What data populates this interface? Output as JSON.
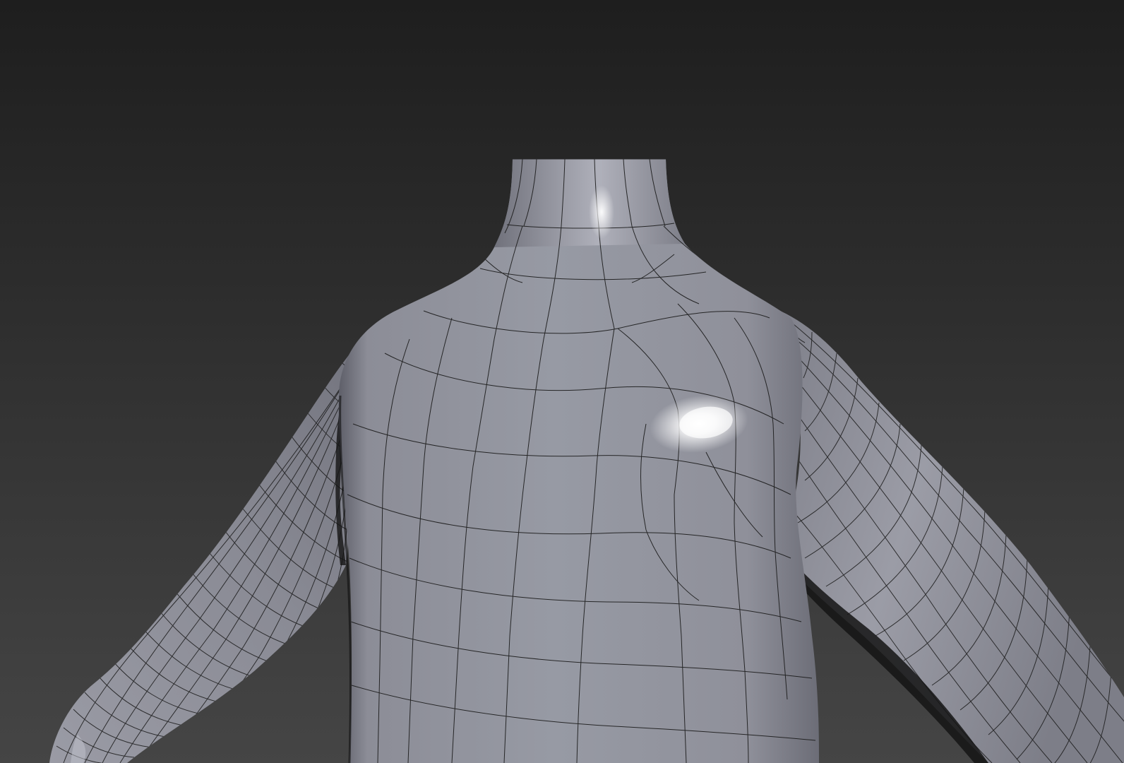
{
  "viewport": {
    "background_top": "#1e1e1e",
    "background_bottom": "#454545",
    "mesh_base_color": "#8d8e98",
    "mesh_dark_color": "#5b5c66",
    "mesh_light_color": "#a9aab4",
    "wire_color": "#1a1a1a",
    "shadow_color": "#141414",
    "specular_color": "#ffffff"
  }
}
